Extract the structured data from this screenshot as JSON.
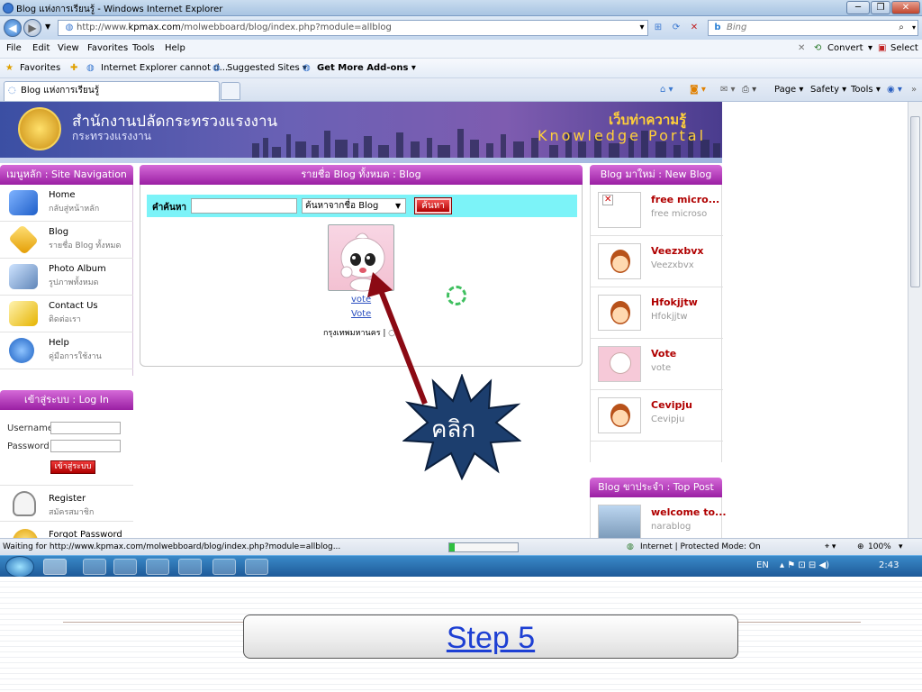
{
  "window": {
    "title": "Blog แห่งการเรียนรู้ - Windows Internet Explorer",
    "minimize": "─",
    "restore": "❐",
    "close": "✕"
  },
  "address": {
    "url_prefix": "http://www.",
    "url_domain": "kpmax.com",
    "url_path": "/molwebboard/blog/index.php?module=allblog",
    "search_placeholder": "Bing"
  },
  "menu": [
    "File",
    "Edit",
    "View",
    "Favorites",
    "Tools",
    "Help"
  ],
  "menu_right": {
    "convert": "Convert",
    "select": "Select"
  },
  "favorites_bar": {
    "favorites": "Favorites",
    "items": [
      "Internet Explorer cannot d...",
      "Suggested Sites ▾",
      "Get More Add-ons ▾"
    ]
  },
  "tab": {
    "title": "Blog แห่งการเรียนรู้"
  },
  "commands": {
    "page": "Page ▾",
    "safety": "Safety ▾",
    "tools": "Tools ▾"
  },
  "site": {
    "org_title": "สำนักงานปลัดกระทรวงแรงงาน",
    "org_subtitle": "กระทรวงแรงงาน",
    "portal_thai": "เว็บท่าความรู้",
    "portal_en": "Knowledge Portal"
  },
  "nav": {
    "header": "เมนูหลัก : Site Navigation",
    "items": [
      {
        "label": "Home",
        "sub": "กลับสู่หน้าหลัก"
      },
      {
        "label": "Blog",
        "sub": "รายชื่อ Blog ทั้งหมด"
      },
      {
        "label": "Photo Album",
        "sub": "รูปภาพทั้งหมด"
      },
      {
        "label": "Contact Us",
        "sub": "ติดต่อเรา"
      },
      {
        "label": "Help",
        "sub": "คู่มือการใช้งาน"
      }
    ]
  },
  "login": {
    "header": "เข้าสู่ระบบ : Log In",
    "username": "Username",
    "password": "Password",
    "button": "เข้าสู่ระบบ",
    "register": "Register",
    "register_sub": "สมัครสมาชิก",
    "forgot": "Forgot Password"
  },
  "main": {
    "header": "รายชื่อ Blog ทั้งหมด : Blog",
    "search_label": "คำค้นหา",
    "search_select": "ค้นหาจากชื่อ Blog",
    "search_button": "ค้นหา",
    "blog_link1": "vote",
    "blog_link2": "Vote",
    "blog_province": "กรุงเทพมหานคร | ◌"
  },
  "new_blog": {
    "header": "Blog มาใหม่ : New Blog",
    "items": [
      {
        "title": "free micro...",
        "sub": "free microso"
      },
      {
        "title": "Veezxbvx",
        "sub": "Veezxbvx"
      },
      {
        "title": "Hfokjjtw",
        "sub": "Hfokjjtw"
      },
      {
        "title": "Vote",
        "sub": "vote"
      },
      {
        "title": "Cevipju",
        "sub": "Cevipju"
      }
    ]
  },
  "top_post": {
    "header": "Blog ขาประจำ : Top Post",
    "items": [
      {
        "title": "welcome to...",
        "sub": "narablog"
      }
    ]
  },
  "status": {
    "text": "Waiting for http://www.kpmax.com/molwebboard/blog/index.php?module=allblog...",
    "zone": "Internet | Protected Mode: On",
    "zoom": "100%",
    "progress": 0.08
  },
  "taskbar": {
    "lang": "EN",
    "time": "2:43"
  },
  "annotation": {
    "callout": "คลิก"
  },
  "slide": {
    "step": "Step 5"
  },
  "colors": {
    "accent_purple": "#9a1fa3",
    "search_bar": "#7cf3f8",
    "link_blue": "#1d3fd3",
    "star_fill": "#1c3e6e",
    "arrow": "#8b0a14"
  }
}
